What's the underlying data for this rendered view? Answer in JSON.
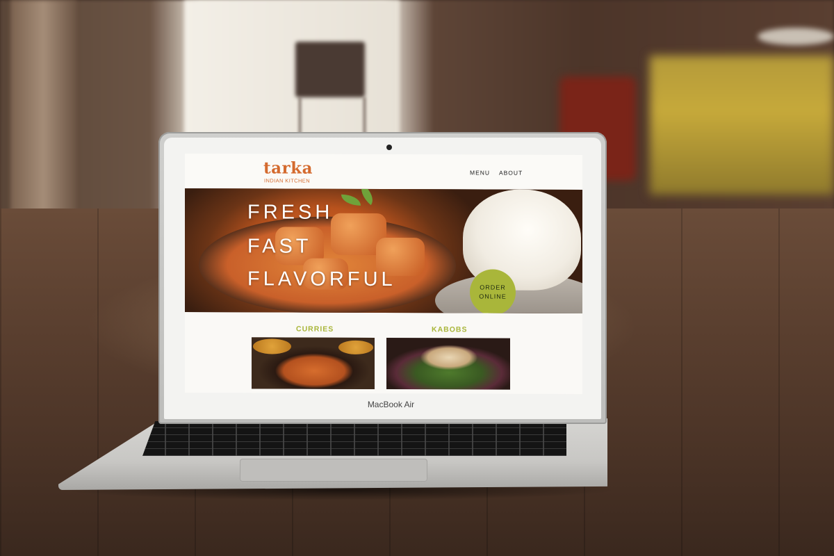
{
  "device": {
    "brand_label": "MacBook Air"
  },
  "site": {
    "logo": {
      "name": "tarka",
      "tagline": "INDIAN KITCHEN"
    },
    "nav": {
      "menu": "MENU",
      "about": "ABOUT"
    },
    "hero": {
      "lines": [
        "FRESH",
        "FAST",
        "FLAVORFUL"
      ],
      "cta_line1": "ORDER",
      "cta_line2": "ONLINE"
    },
    "categories": [
      {
        "label": "CURRIES"
      },
      {
        "label": "KABOBS"
      }
    ]
  },
  "colors": {
    "brand_orange": "#d46a2e",
    "accent_green": "#a9b63a"
  }
}
